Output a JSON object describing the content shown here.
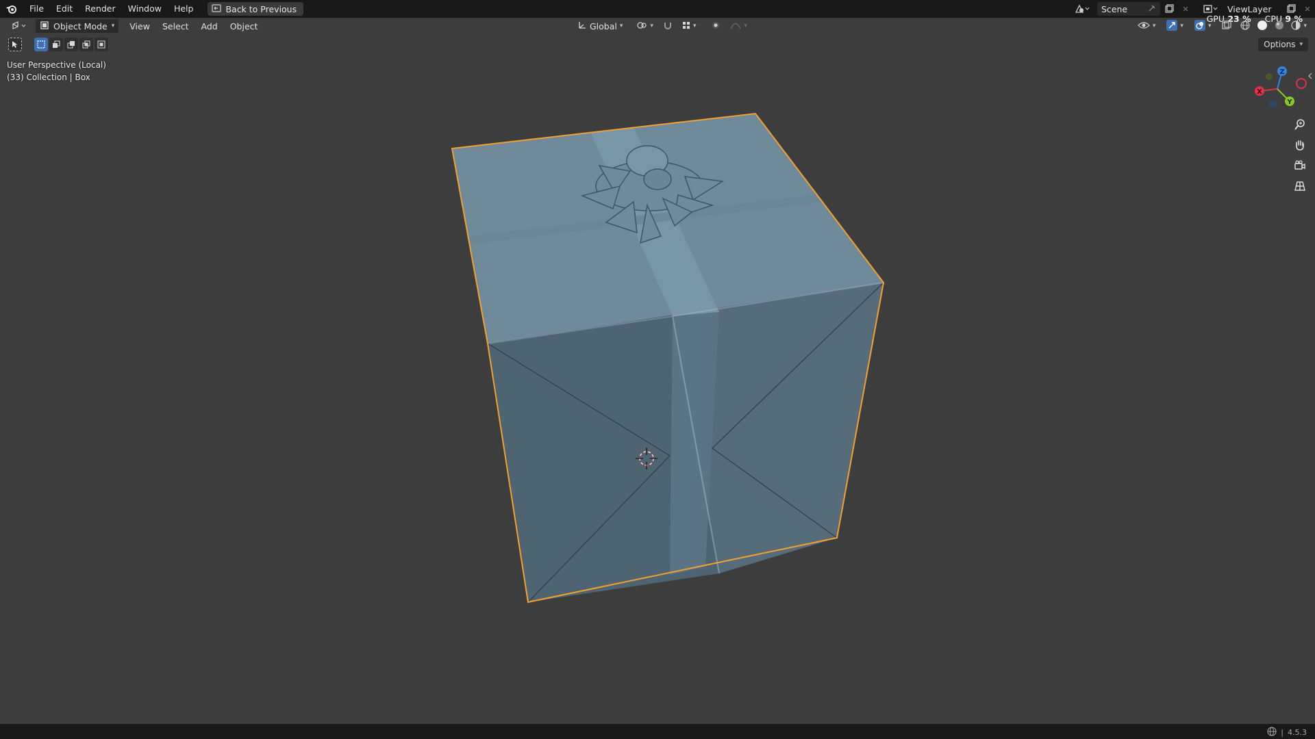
{
  "topbar": {
    "menu": [
      "File",
      "Edit",
      "Render",
      "Window",
      "Help"
    ],
    "back_button": "Back to Previous",
    "scene_name": "Scene",
    "view_layer": "ViewLayer",
    "gpu_label": "GPU",
    "gpu_value": "23 %",
    "cpu_label": "CPU",
    "cpu_value": "9 %"
  },
  "header": {
    "mode": "Object Mode",
    "menus": [
      "View",
      "Select",
      "Add",
      "Object"
    ],
    "transform_orientation": "Global",
    "options_label": "Options"
  },
  "viewport": {
    "perspective": "User Perspective (Local)",
    "collection": "(33) Collection | Box"
  },
  "gizmo": {
    "x": "X",
    "y": "Y",
    "z": "Z",
    "x_color": "#e0334a",
    "y_color": "#8bc924",
    "z_color": "#2f86e6"
  },
  "colors": {
    "selection_outline": "#f5a030",
    "box_color": "#5f7a8a"
  },
  "status": {
    "version": "4.5.3"
  }
}
